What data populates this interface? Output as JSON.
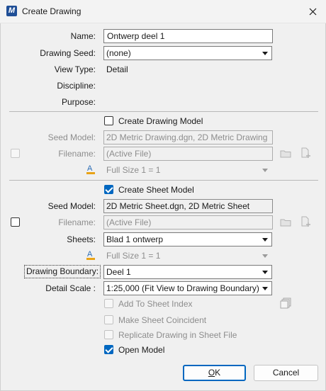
{
  "window": {
    "title": "Create Drawing",
    "app_icon": "M"
  },
  "form": {
    "name_label": "Name:",
    "name_value": "Ontwerp deel 1",
    "drawing_seed_label": "Drawing Seed:",
    "drawing_seed_value": "(none)",
    "view_type_label": "View Type:",
    "view_type_value": "Detail",
    "discipline_label": "Discipline:",
    "purpose_label": "Purpose:"
  },
  "drawing_model": {
    "checkbox_label": "Create Drawing Model",
    "checked": false,
    "seed_model_label": "Seed Model:",
    "seed_model_value": "2D Metric Drawing.dgn, 2D Metric Drawing",
    "filename_label": "Filename:",
    "filename_value": "(Active File)",
    "annotation_scale_value": "Full Size 1 = 1"
  },
  "sheet_model": {
    "checkbox_label": "Create Sheet Model",
    "checked": true,
    "seed_model_label": "Seed Model:",
    "seed_model_value": "2D Metric Sheet.dgn, 2D Metric Sheet",
    "filename_label": "Filename:",
    "filename_value": "(Active File)",
    "sheets_label": "Sheets:",
    "sheets_value": "Blad 1 ontwerp",
    "annotation_scale_value": "Full Size 1 = 1",
    "drawing_boundary_label": "Drawing Boundary:",
    "drawing_boundary_value": "Deel 1",
    "detail_scale_label": "Detail Scale :",
    "detail_scale_value": "1:25,000 (Fit View to Drawing Boundary)"
  },
  "options": {
    "add_to_sheet_index": "Add To Sheet Index",
    "make_sheet_coincident": "Make Sheet Coincident",
    "replicate_drawing": "Replicate Drawing in Sheet File",
    "open_model": "Open Model"
  },
  "buttons": {
    "ok_accel": "O",
    "ok_rest": "K",
    "cancel": "Cancel"
  },
  "colors": {
    "accent": "#0067c0",
    "disabled_text": "#8d8d8d",
    "dialog_bg": "#f0f0f0",
    "annotation_icon": "#e8a317"
  }
}
